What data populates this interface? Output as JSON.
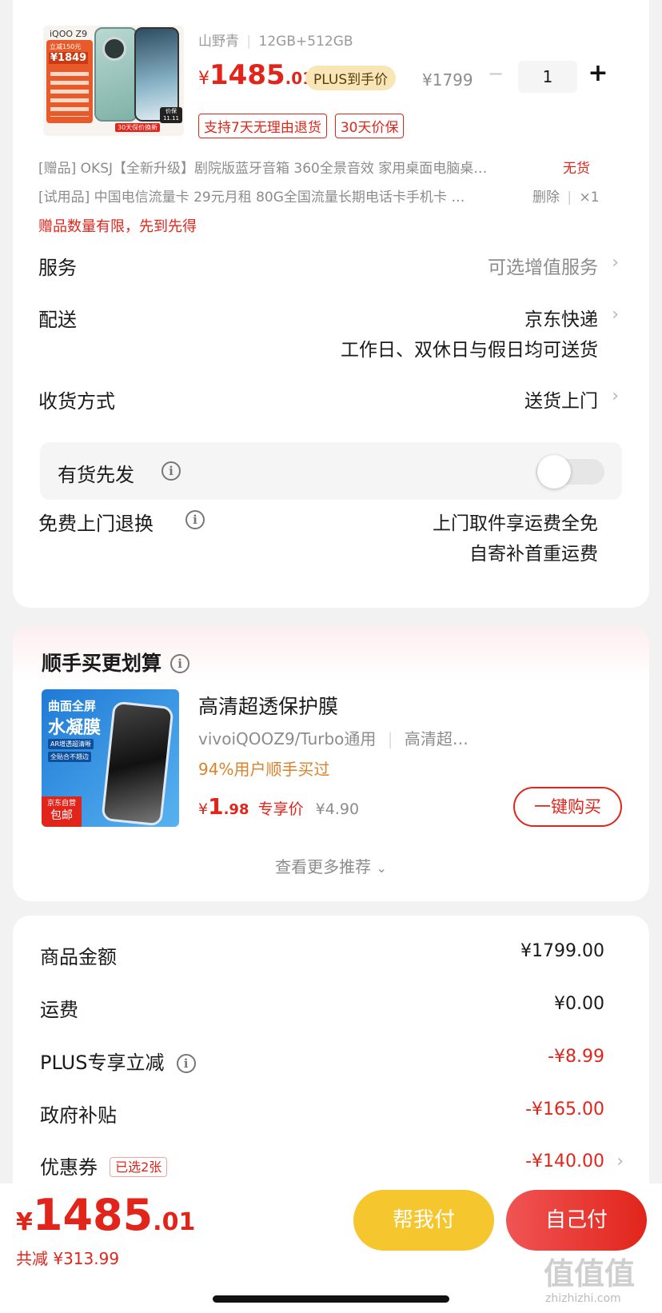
{
  "product": {
    "thumb_brand": "iQOO Z9",
    "thumb_badge": "立减150元",
    "thumb_price": "¥1849",
    "thumb_stamp": "价保 11.11",
    "thumb_caption": "30天保价换新",
    "variant_color": "山野青",
    "variant_spec": "12GB+512GB",
    "price_symbol": "¥",
    "price_int": "1485",
    "price_dec": ".01",
    "plus_badge": "PLUS到手价",
    "orig_price": "¥1799",
    "qty_minus": "−",
    "quantity": "1",
    "qty_plus": "+",
    "tags": [
      "支持7天无理由退货",
      "30天价保"
    ]
  },
  "gifts": [
    {
      "text": "[赠品] OKSJ【全新升级】剧院版蓝牙音箱 360全景音效 家用桌面电脑桌…",
      "status": "无货"
    },
    {
      "text": "[试用品] 中国电信流量卡 29元月租 80G全国流量长期电话卡手机卡 …",
      "action": "删除",
      "qty": "×1"
    }
  ],
  "gift_notice": "赠品数量有限，先到先得",
  "service": {
    "label": "服务",
    "value": "可选增值服务"
  },
  "delivery": {
    "label": "配送",
    "value": "京东快递",
    "note": "工作日、双休日与假日均可送货"
  },
  "receive": {
    "label": "收货方式",
    "value": "送货上门"
  },
  "stock_first": {
    "label": "有货先发",
    "enabled": false
  },
  "free_return": {
    "label": "免费上门退换",
    "line1": "上门取件享运费全免",
    "line2": "自寄补首重运费"
  },
  "addon": {
    "title": "顺手买更划算",
    "thumb_line1": "曲面全屏",
    "thumb_line2": "水凝膜",
    "thumb_chip1": "AR增透超清晰",
    "thumb_chip2": "全贴合不翘边",
    "thumb_corner1": "京东自营",
    "thumb_corner2": "包邮",
    "name": "高清超透保护膜",
    "compat": "vivoiQOOZ9/Turbo通用",
    "variant": "高清超…",
    "stat": "94%用户顺手买过",
    "price_symbol": "¥",
    "price_int": "1",
    "price_dec": ".98",
    "price_label": "专享价",
    "orig_price": "¥4.90",
    "buy_button": "一键购买",
    "more": "查看更多推荐"
  },
  "summary": [
    {
      "label": "商品金额",
      "value": "¥1799.00",
      "color": "#1a1a1a"
    },
    {
      "label": "运费",
      "value": "¥0.00",
      "color": "#1a1a1a"
    },
    {
      "label": "PLUS专享立减",
      "value": "-¥8.99",
      "color": "#e1251b"
    },
    {
      "label": "政府补贴",
      "value": "-¥165.00",
      "color": "#e1251b"
    },
    {
      "label": "优惠券",
      "value": "-¥140.00",
      "color": "#e1251b",
      "tag": "已选2张"
    }
  ],
  "footer": {
    "total_symbol": "¥",
    "total_int": "1485",
    "total_dec": ".01",
    "saved": "共减 ¥313.99",
    "help_pay": "帮我付",
    "self_pay": "自己付"
  },
  "watermark": {
    "logo": "值",
    "site": "zhizhizhi.com"
  },
  "colors": {
    "accent": "#e1251b",
    "help_btn": "#f6c62f",
    "self_btn": "#e93b3b",
    "addon_orange": "#d9822b"
  }
}
